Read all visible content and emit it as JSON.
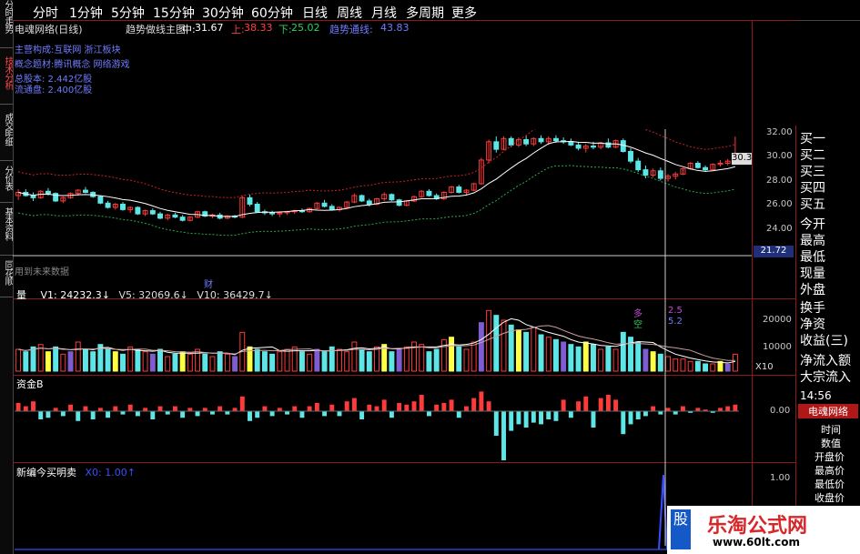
{
  "left_tabs": [
    "分时走势",
    "技术分析",
    "成交明细",
    "分价表",
    "基本资料",
    "同花顺"
  ],
  "menu": {
    "items": [
      "分时",
      "1分钟",
      "5分钟",
      "15分钟",
      "30分钟",
      "60分钟",
      "日线",
      "周线",
      "月线",
      "多周期",
      "更多"
    ]
  },
  "title": {
    "stock": "电魂网络(日线)",
    "indicator": "趋势做线主图",
    "mid_label": "中:",
    "mid_value": "31.67",
    "up_label": "上:",
    "up_value": "38.33",
    "down_label": "下:",
    "down_value": "25.02",
    "trend_label": "趋势通线:",
    "trend_value": "43.83"
  },
  "info": {
    "line1": "主营构成:互联网  浙江板块",
    "line2": "概念题材:腾讯概念 网络游戏",
    "line3": "总股本: 2.442亿股",
    "line4": "流通盘: 2.400亿股",
    "future": "用到未来数据",
    "cai": "财"
  },
  "price_axis": [
    "32.00",
    "30.00",
    "28.00",
    "26.00",
    "24.00",
    "22.00"
  ],
  "price_tag": "30.3",
  "price_tag2": "21.72",
  "volume": {
    "label": "量",
    "v1": "V1: 24232.3↓",
    "v5": "V5: 32069.6↓",
    "v10": "V10: 36429.7↓",
    "axis": [
      "20000",
      "10000"
    ],
    "x10": "X10",
    "duo": "多",
    "duo_val": "2.5",
    "kong": "空",
    "kong_val": "5.2"
  },
  "fund": {
    "label": "资金B",
    "axis": "0.00"
  },
  "buy_sell": {
    "label": "新编今买明卖",
    "x": "X0: 1.00↑",
    "axis": "1.00"
  },
  "right_panel": {
    "items": [
      "买一",
      "买二",
      "买三",
      "买四",
      "买五",
      "今开",
      "最高",
      "最低",
      "现量",
      "外盘",
      "换手",
      "净资",
      "收益(三)",
      "净流入额",
      "大宗流入"
    ],
    "time": "14:56",
    "stock_tag": "电魂网络",
    "sub": [
      "时间",
      "数值",
      "开盘价",
      "最高价",
      "最低价",
      "收盘价"
    ]
  },
  "watermark": {
    "text": "乐淘公式网",
    "url": "www.60lt.com",
    "badge": "股"
  },
  "colors": {
    "up": "#ff3a3a",
    "down": "#5ee6e6",
    "line_white": "#ffffff",
    "line_red_dot": "#cc2222",
    "line_green_dot": "#2aa84a",
    "yellow": "#ffff44",
    "purple": "#7f5ccf",
    "frame": "#8b1a1a"
  },
  "chart_data": {
    "type": "candlestick",
    "ylim": [
      21,
      33
    ],
    "candles": [
      [
        27.0,
        27.6,
        26.6,
        27.3
      ],
      [
        27.3,
        27.6,
        26.9,
        27.0
      ],
      [
        27.0,
        27.3,
        26.5,
        26.8
      ],
      [
        26.8,
        27.5,
        26.7,
        27.4
      ],
      [
        27.4,
        27.7,
        27.0,
        27.2
      ],
      [
        27.2,
        27.3,
        26.4,
        26.5
      ],
      [
        26.5,
        26.9,
        26.3,
        26.8
      ],
      [
        26.8,
        27.3,
        26.7,
        27.2
      ],
      [
        27.2,
        27.6,
        27.0,
        27.5
      ],
      [
        27.5,
        27.8,
        27.2,
        27.3
      ],
      [
        27.3,
        27.4,
        26.8,
        26.9
      ],
      [
        26.9,
        27.0,
        26.2,
        26.3
      ],
      [
        26.3,
        26.5,
        25.8,
        25.9
      ],
      [
        25.9,
        26.3,
        25.7,
        26.2
      ],
      [
        26.2,
        26.4,
        25.6,
        25.7
      ],
      [
        25.7,
        26.0,
        25.4,
        25.9
      ],
      [
        25.9,
        26.0,
        25.2,
        25.3
      ],
      [
        25.3,
        25.7,
        25.1,
        25.6
      ],
      [
        25.6,
        25.8,
        25.2,
        25.3
      ],
      [
        25.3,
        25.5,
        24.8,
        24.9
      ],
      [
        24.9,
        25.3,
        24.7,
        25.2
      ],
      [
        25.2,
        25.4,
        24.9,
        25.0
      ],
      [
        25.0,
        25.2,
        24.6,
        24.7
      ],
      [
        24.7,
        25.1,
        24.6,
        25.0
      ],
      [
        25.0,
        25.6,
        24.9,
        25.5
      ],
      [
        25.5,
        25.6,
        25.0,
        25.1
      ],
      [
        25.1,
        25.3,
        24.9,
        25.2
      ],
      [
        25.2,
        25.4,
        24.8,
        24.9
      ],
      [
        24.9,
        25.2,
        24.8,
        25.1
      ],
      [
        25.1,
        25.2,
        24.9,
        25.0
      ],
      [
        25.0,
        27.0,
        24.9,
        26.8
      ],
      [
        26.8,
        27.1,
        26.0,
        26.2
      ],
      [
        26.2,
        26.4,
        25.4,
        25.5
      ],
      [
        25.5,
        25.7,
        25.2,
        25.4
      ],
      [
        25.4,
        25.6,
        25.1,
        25.3
      ],
      [
        25.3,
        25.5,
        25.0,
        25.4
      ],
      [
        25.4,
        25.6,
        25.2,
        25.5
      ],
      [
        25.5,
        25.7,
        25.3,
        25.6
      ],
      [
        25.6,
        25.8,
        25.4,
        25.5
      ],
      [
        25.5,
        25.9,
        25.4,
        25.8
      ],
      [
        25.8,
        26.4,
        25.7,
        26.3
      ],
      [
        26.3,
        26.6,
        25.9,
        26.0
      ],
      [
        26.0,
        26.2,
        25.6,
        25.7
      ],
      [
        25.7,
        26.0,
        25.5,
        25.9
      ],
      [
        25.9,
        26.5,
        25.8,
        26.4
      ],
      [
        26.4,
        27.2,
        26.3,
        27.0
      ],
      [
        27.0,
        27.1,
        26.4,
        26.5
      ],
      [
        26.5,
        26.7,
        26.0,
        26.2
      ],
      [
        26.2,
        26.8,
        26.1,
        26.7
      ],
      [
        26.7,
        27.3,
        26.5,
        27.1
      ],
      [
        27.1,
        27.2,
        26.5,
        26.6
      ],
      [
        26.6,
        26.7,
        26.0,
        26.1
      ],
      [
        26.1,
        26.6,
        26.0,
        26.5
      ],
      [
        26.5,
        27.0,
        26.4,
        26.9
      ],
      [
        26.9,
        27.5,
        26.8,
        27.4
      ],
      [
        27.4,
        27.6,
        26.9,
        27.0
      ],
      [
        27.0,
        27.2,
        26.6,
        26.7
      ],
      [
        26.7,
        27.4,
        26.6,
        27.3
      ],
      [
        27.3,
        27.9,
        27.2,
        27.8
      ],
      [
        27.8,
        28.0,
        27.2,
        27.3
      ],
      [
        27.3,
        27.6,
        27.0,
        27.5
      ],
      [
        27.5,
        28.2,
        27.4,
        28.1
      ],
      [
        28.1,
        30.5,
        28.0,
        30.3
      ],
      [
        30.3,
        32.2,
        30.0,
        32.0
      ],
      [
        32.0,
        32.5,
        31.0,
        31.3
      ],
      [
        31.3,
        32.5,
        31.2,
        32.3
      ],
      [
        32.3,
        32.5,
        31.5,
        31.7
      ],
      [
        31.7,
        32.4,
        31.5,
        32.2
      ],
      [
        32.2,
        32.6,
        31.6,
        31.8
      ],
      [
        31.8,
        32.4,
        31.6,
        32.3
      ],
      [
        32.3,
        32.6,
        31.8,
        32.0
      ],
      [
        32.0,
        32.5,
        31.7,
        32.3
      ],
      [
        32.3,
        32.6,
        31.9,
        32.1
      ],
      [
        32.1,
        32.4,
        31.8,
        32.0
      ],
      [
        32.0,
        32.3,
        31.6,
        31.7
      ],
      [
        31.7,
        32.0,
        31.2,
        31.4
      ],
      [
        31.4,
        31.8,
        31.0,
        31.6
      ],
      [
        31.6,
        32.0,
        31.3,
        31.5
      ],
      [
        31.5,
        32.0,
        31.3,
        31.9
      ],
      [
        31.9,
        32.3,
        31.4,
        31.5
      ],
      [
        31.5,
        32.2,
        31.4,
        32.1
      ],
      [
        32.1,
        32.3,
        31.0,
        31.1
      ],
      [
        31.1,
        31.4,
        30.0,
        30.2
      ],
      [
        30.2,
        30.5,
        29.2,
        29.4
      ],
      [
        29.4,
        29.8,
        28.6,
        28.9
      ],
      [
        28.9,
        29.5,
        28.7,
        29.3
      ],
      [
        29.3,
        29.6,
        28.4,
        28.6
      ],
      [
        28.6,
        29.0,
        28.3,
        28.8
      ],
      [
        28.8,
        29.2,
        28.5,
        29.0
      ],
      [
        29.0,
        29.6,
        28.9,
        29.5
      ],
      [
        29.5,
        30.1,
        29.4,
        30.0
      ],
      [
        30.0,
        30.2,
        29.5,
        29.6
      ],
      [
        29.6,
        29.8,
        29.2,
        29.4
      ],
      [
        29.4,
        30.0,
        29.3,
        29.9
      ],
      [
        29.9,
        30.3,
        29.7,
        30.0
      ],
      [
        30.0,
        30.4,
        29.8,
        30.2
      ],
      [
        30.2,
        32.5,
        30.1,
        30.4
      ]
    ],
    "volumes": [
      9,
      8,
      10,
      11,
      8,
      10,
      7,
      8,
      12,
      9,
      8,
      11,
      9,
      8,
      7,
      10,
      9,
      8,
      7,
      9,
      6,
      7,
      8,
      7,
      9,
      7,
      6,
      8,
      7,
      6,
      16,
      10,
      9,
      8,
      7,
      8,
      9,
      10,
      8,
      7,
      9,
      8,
      10,
      9,
      8,
      12,
      9,
      8,
      10,
      11,
      8,
      9,
      10,
      12,
      11,
      8,
      9,
      13,
      14,
      10,
      9,
      12,
      20,
      25,
      23,
      21,
      19,
      17,
      16,
      18,
      15,
      14,
      13,
      12,
      11,
      10,
      12,
      11,
      9,
      10,
      9,
      16,
      14,
      12,
      9,
      8,
      7,
      6,
      5,
      5,
      4,
      4,
      3,
      3,
      4,
      3,
      7
    ],
    "fund": [
      0.5,
      0.3,
      0.6,
      -0.5,
      -0.4,
      0.2,
      -0.3,
      0.4,
      -0.6,
      0.3,
      -0.5,
      0.2,
      -0.4,
      0.3,
      -0.2,
      0.4,
      -0.3,
      0.2,
      -0.5,
      0.3,
      -0.2,
      0.3,
      -0.4,
      0.2,
      -0.3,
      0.2,
      -0.2,
      0.3,
      -0.2,
      0.2,
      0.9,
      -0.6,
      -0.4,
      0.3,
      -0.3,
      0.2,
      -0.2,
      0.3,
      -0.4,
      0.3,
      0.5,
      -0.3,
      0.4,
      -0.3,
      0.6,
      0.8,
      -0.5,
      0.4,
      0.3,
      0.7,
      -0.4,
      0.5,
      0.4,
      0.6,
      1.0,
      -0.3,
      0.4,
      0.5,
      0.7,
      -0.4,
      0.3,
      0.8,
      1.2,
      0.6,
      -1.5,
      -3.0,
      -1.2,
      -0.8,
      -1.0,
      -0.7,
      -0.8,
      -0.5,
      -0.6,
      0.7,
      -0.4,
      0.6,
      0.9,
      -1.0,
      0.8,
      1.0,
      0.7,
      -1.4,
      -0.8,
      -0.5,
      -0.3,
      0.3,
      -0.2,
      0.2,
      -0.2,
      0.3,
      -0.1,
      0.2,
      0.1,
      -0.1,
      0.2,
      0.3,
      0.4
    ]
  }
}
